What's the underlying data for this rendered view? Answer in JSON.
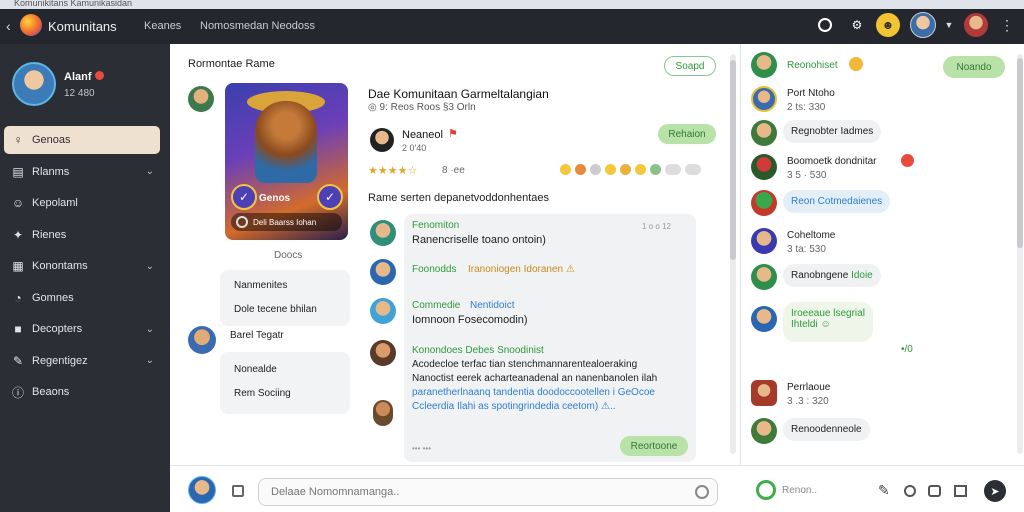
{
  "window": {
    "strip_title": "Komunikitans Kamunikasidan"
  },
  "topbar": {
    "app_title": "Komunitans",
    "tabs": [
      "Keanes",
      "Nomosmedan Neodoss"
    ],
    "icons": [
      "search-icon",
      "gear-icon",
      "game-icon",
      "avatar",
      "chevron-down-icon",
      "user-avatar",
      "more-icon"
    ]
  },
  "profile": {
    "name": "Alanf",
    "sub": "12 480"
  },
  "sidebar": {
    "items": [
      {
        "icon": "person-icon",
        "label": "Genoas",
        "active": true,
        "chevron": false
      },
      {
        "icon": "list-icon",
        "label": "Rlanms",
        "active": false,
        "chevron": true
      },
      {
        "icon": "user-icon",
        "label": "Kepolaml",
        "active": false,
        "chevron": false
      },
      {
        "icon": "puzzle-icon",
        "label": "Rienes",
        "active": false,
        "chevron": false
      },
      {
        "icon": "grid-icon",
        "label": "Konontams",
        "active": false,
        "chevron": true
      },
      {
        "icon": "palette-icon",
        "label": "Gomnes",
        "active": false,
        "chevron": false
      },
      {
        "icon": "square-icon",
        "label": "Decopters",
        "active": false,
        "chevron": true
      },
      {
        "icon": "pen-icon",
        "label": "Regentigez",
        "active": false,
        "chevron": true
      },
      {
        "icon": "info-icon",
        "label": "Beaons",
        "active": false,
        "chevron": false
      }
    ]
  },
  "main": {
    "breadcrumb": "Rormontae Rame",
    "top_button": "Soapd",
    "card": {
      "title": "Genos",
      "footer": "Deli Baarss Iohan"
    },
    "card_caption": "Doocs",
    "post_title": "Dae Komunitaan Garmeltalangian",
    "post_meta": "◎ 9: Reos Roos §3 Orln",
    "author_name": "Neaneol",
    "author_meta": "2 0'40",
    "follow_button": "Rehaion",
    "rating_stars": "★★★★☆",
    "rating_count": "8 ·ee",
    "section_title": "Rame serten depanetvoddonhentaes",
    "left_info": [
      "Nanmenites",
      "Dole tecene bhilan"
    ],
    "left_author": "Barel Tegatr",
    "left_info2": [
      "Nonealde",
      "Rem Sociing"
    ],
    "comments": [
      {
        "name": "Fenomiton",
        "time": "1 o o 12",
        "text": "Ranencriselle toano ontoin)"
      },
      {
        "name": "Foonodds",
        "name2": "Iranoniogen Idoranen ⚠",
        "text": ""
      },
      {
        "name": "Commedie",
        "name2": "Nentidoict",
        "text": "Iomnoon Fosecomodin)"
      },
      {
        "name": "Konondoes Debes Snoodinist",
        "lines": [
          "Acodecloe terfac tian stenchmannarentealoeraking",
          "Nanoctist eerek acharteanadenal an nanenbanolen ilah",
          "paranetherlnaanq tandentia doodoccootellen i GeOcoe",
          "Ccleerdia Ilahi as spotingrindedia ceetom) ⚠.."
        ]
      }
    ],
    "comments_time": "••• •••",
    "reply_button": "Reortoone"
  },
  "right": {
    "top_button": "Noando",
    "items": [
      {
        "name": "Reonohiset",
        "kind": "green-name"
      },
      {
        "name": "Port Ntoho",
        "sub": "2 ts: 330"
      },
      {
        "name": "Regnobter Iadmes",
        "kind": "bubble"
      },
      {
        "name": "Boomoetk dondnitar",
        "sub": "3 5 · 530"
      },
      {
        "name": "Reon Cotmedaienes",
        "kind": "bubble-green"
      },
      {
        "name": "Coheltome",
        "sub": "3 ta: 530"
      },
      {
        "name": "Ranobngene",
        "name2": "Idoie",
        "kind": "bubble"
      },
      {
        "lines": [
          "Iroeeaue lsegrial",
          "Ihteldi ☺"
        ],
        "kind": "bubble-green2"
      },
      {
        "name": "Perrlaoue",
        "sub": "3 .3 : 320"
      },
      {
        "name": "Renoodenneole",
        "kind": "bubble"
      }
    ],
    "mark": "•/0"
  },
  "bottom": {
    "composer_placeholder": "Delaae Nomomnamanga..",
    "right_input": "Renon..",
    "icons": [
      "image-icon",
      "emoji-icon",
      "mic-icon",
      "at-icon",
      "gallery-icon",
      "send-icon"
    ]
  }
}
